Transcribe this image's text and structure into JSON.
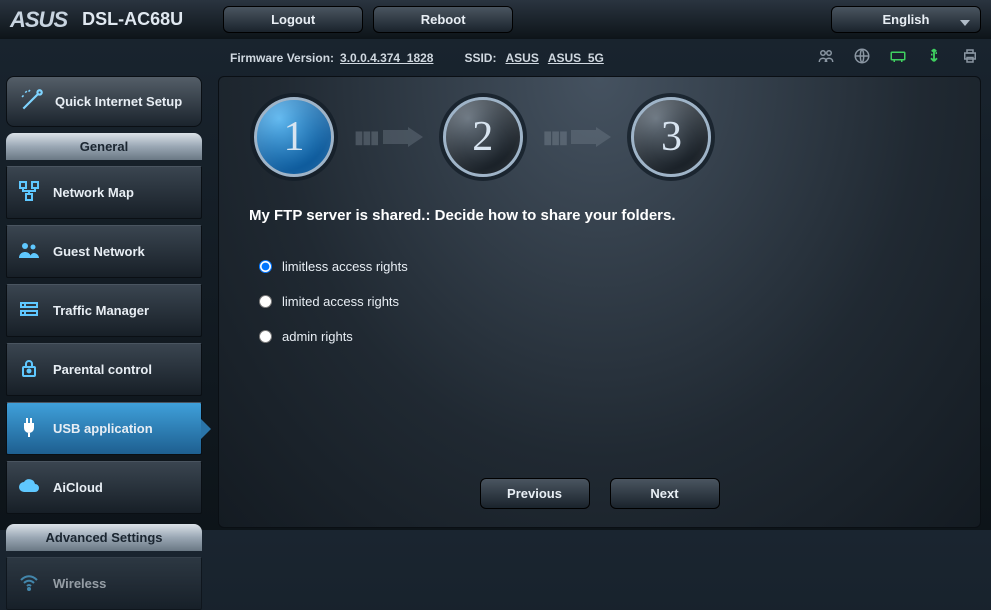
{
  "header": {
    "brand": "ASUS",
    "model": "DSL-AC68U",
    "logout": "Logout",
    "reboot": "Reboot",
    "language": "English"
  },
  "info": {
    "fw_label": "Firmware Version:",
    "fw_value": "3.0.0.4.374_1828",
    "ssid_label": "SSID:",
    "ssid1": "ASUS",
    "ssid2": "ASUS_5G"
  },
  "sidebar": {
    "qis": "Quick Internet Setup",
    "general_head": "General",
    "items": [
      "Network Map",
      "Guest Network",
      "Traffic Manager",
      "Parental control",
      "USB application",
      "AiCloud"
    ],
    "advanced_head": "Advanced Settings",
    "wireless": "Wireless"
  },
  "main": {
    "step1": "1",
    "step2": "2",
    "step3": "3",
    "title": "My FTP server is shared.: Decide how to share your folders.",
    "opt_limitless": "limitless access rights",
    "opt_limited": "limited access rights",
    "opt_admin": "admin rights",
    "prev": "Previous",
    "next": "Next"
  }
}
